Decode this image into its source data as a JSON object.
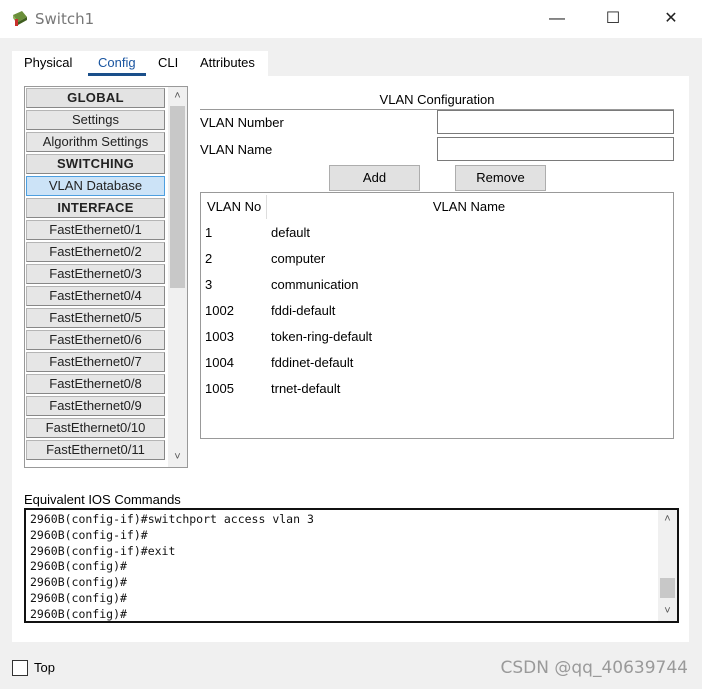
{
  "window": {
    "title": "Switch1",
    "minimize_glyph": "—",
    "maximize_glyph": "☐",
    "close_glyph": "✕",
    "icon": "packet-tracer-switch-icon"
  },
  "tabs": [
    "Physical",
    "Config",
    "CLI",
    "Attributes"
  ],
  "active_tab": "Config",
  "nav": {
    "items": [
      {
        "label": "GLOBAL",
        "kind": "header"
      },
      {
        "label": "Settings",
        "kind": "item"
      },
      {
        "label": "Algorithm Settings",
        "kind": "item"
      },
      {
        "label": "SWITCHING",
        "kind": "header"
      },
      {
        "label": "VLAN Database",
        "kind": "selected"
      },
      {
        "label": "INTERFACE",
        "kind": "header"
      },
      {
        "label": "FastEthernet0/1",
        "kind": "item"
      },
      {
        "label": "FastEthernet0/2",
        "kind": "item"
      },
      {
        "label": "FastEthernet0/3",
        "kind": "item"
      },
      {
        "label": "FastEthernet0/4",
        "kind": "item"
      },
      {
        "label": "FastEthernet0/5",
        "kind": "item"
      },
      {
        "label": "FastEthernet0/6",
        "kind": "item"
      },
      {
        "label": "FastEthernet0/7",
        "kind": "item"
      },
      {
        "label": "FastEthernet0/8",
        "kind": "item"
      },
      {
        "label": "FastEthernet0/9",
        "kind": "item"
      },
      {
        "label": "FastEthernet0/10",
        "kind": "item"
      },
      {
        "label": "FastEthernet0/11",
        "kind": "item"
      }
    ],
    "scroll_up": "˄",
    "scroll_down": "˅"
  },
  "vlan_config": {
    "title": "VLAN Configuration",
    "number_label": "VLAN Number",
    "number_value": "",
    "name_label": "VLAN Name",
    "name_value": "",
    "add_label": "Add",
    "remove_label": "Remove",
    "columns": [
      "VLAN No",
      "VLAN Name"
    ],
    "rows": [
      {
        "no": "1",
        "name": "default"
      },
      {
        "no": "2",
        "name": "computer"
      },
      {
        "no": "3",
        "name": "communication"
      },
      {
        "no": "1002",
        "name": "fddi-default"
      },
      {
        "no": "1003",
        "name": "token-ring-default"
      },
      {
        "no": "1004",
        "name": "fddinet-default"
      },
      {
        "no": "1005",
        "name": "trnet-default"
      }
    ]
  },
  "ios": {
    "label": "Equivalent IOS Commands",
    "lines": [
      "2960B(config-if)#switchport access vlan 3",
      "2960B(config-if)#",
      "2960B(config-if)#exit",
      "2960B(config)#",
      "2960B(config)#",
      "2960B(config)#",
      "2960B(config)#"
    ]
  },
  "bottom": {
    "top_label": "Top",
    "top_checked": false,
    "watermark": "CSDN @qq_40639744"
  }
}
